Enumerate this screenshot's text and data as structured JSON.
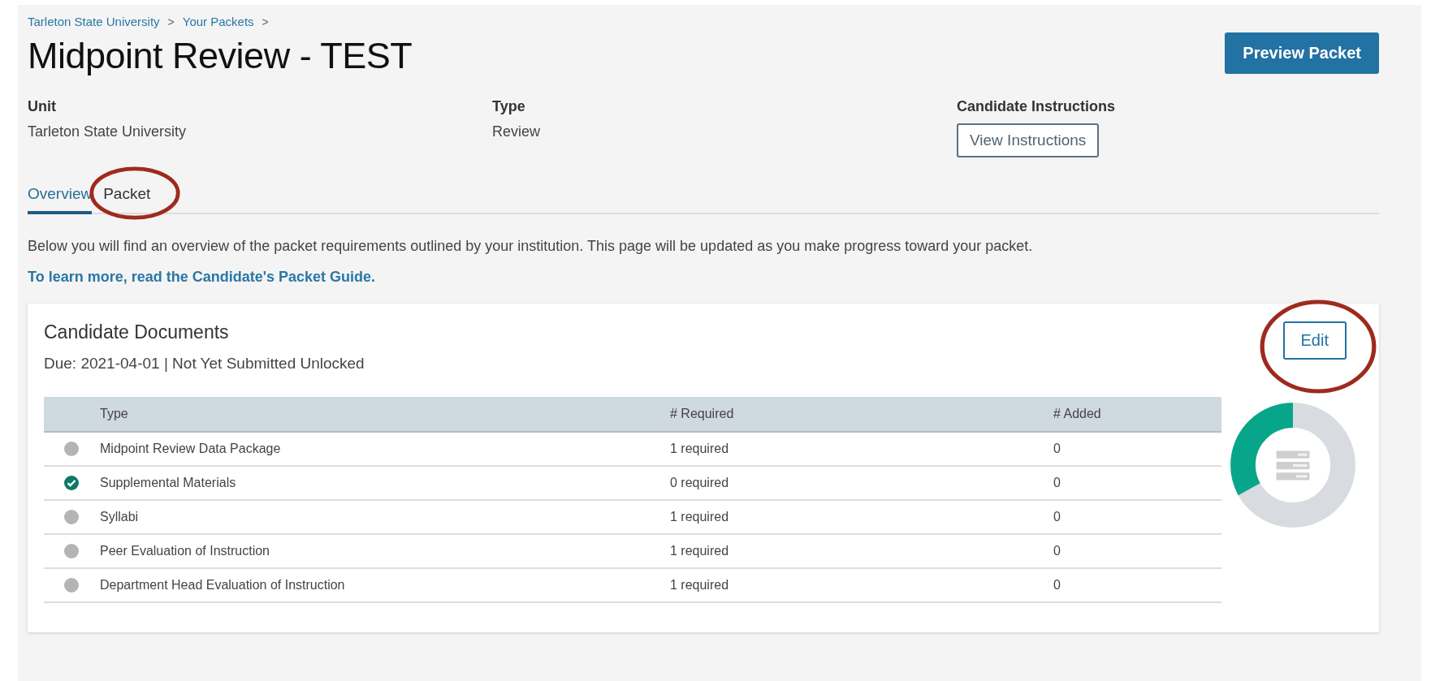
{
  "breadcrumbs": [
    "Tarleton State University",
    "Your Packets"
  ],
  "breadcrumb_separator": ">",
  "title": "Midpoint Review - TEST",
  "preview_button": "Preview Packet",
  "details": [
    {
      "kind": "text",
      "label": "Unit",
      "value": "Tarleton State University"
    },
    {
      "kind": "text",
      "label": "Type",
      "value": "Review"
    },
    {
      "kind": "button",
      "label": "Candidate Instructions",
      "value": "View Instructions"
    }
  ],
  "tabs": [
    {
      "label": "Overview",
      "selected": true,
      "highlighted": false
    },
    {
      "label": "Packet",
      "selected": false,
      "highlighted": true
    }
  ],
  "intro": {
    "text": "Below you will find an overview of the packet requirements outlined by your institution. This page will be updated as you make progress toward your packet.",
    "link": "To learn more, read the Candidate's Packet Guide."
  },
  "card": {
    "title": "Candidate Documents",
    "subtitle": "Due: 2021-04-01 | Not Yet Submitted Unlocked",
    "edit_button": {
      "label": "Edit",
      "highlighted": true
    },
    "table": {
      "columns": [
        "Type",
        "# Required",
        "# Added"
      ],
      "rows": [
        {
          "complete": false,
          "type": "Midpoint Review Data Package",
          "required": "1 required",
          "added": "0"
        },
        {
          "complete": true,
          "type": "Supplemental Materials",
          "required": "0 required",
          "added": "0"
        },
        {
          "complete": false,
          "type": "Syllabi",
          "required": "1 required",
          "added": "0"
        },
        {
          "complete": false,
          "type": "Peer Evaluation of Instruction",
          "required": "1 required",
          "added": "0"
        },
        {
          "complete": false,
          "type": "Department Head Evaluation of Instruction",
          "required": "1 required",
          "added": "0"
        }
      ]
    },
    "progress": {
      "level": 0.33
    }
  }
}
